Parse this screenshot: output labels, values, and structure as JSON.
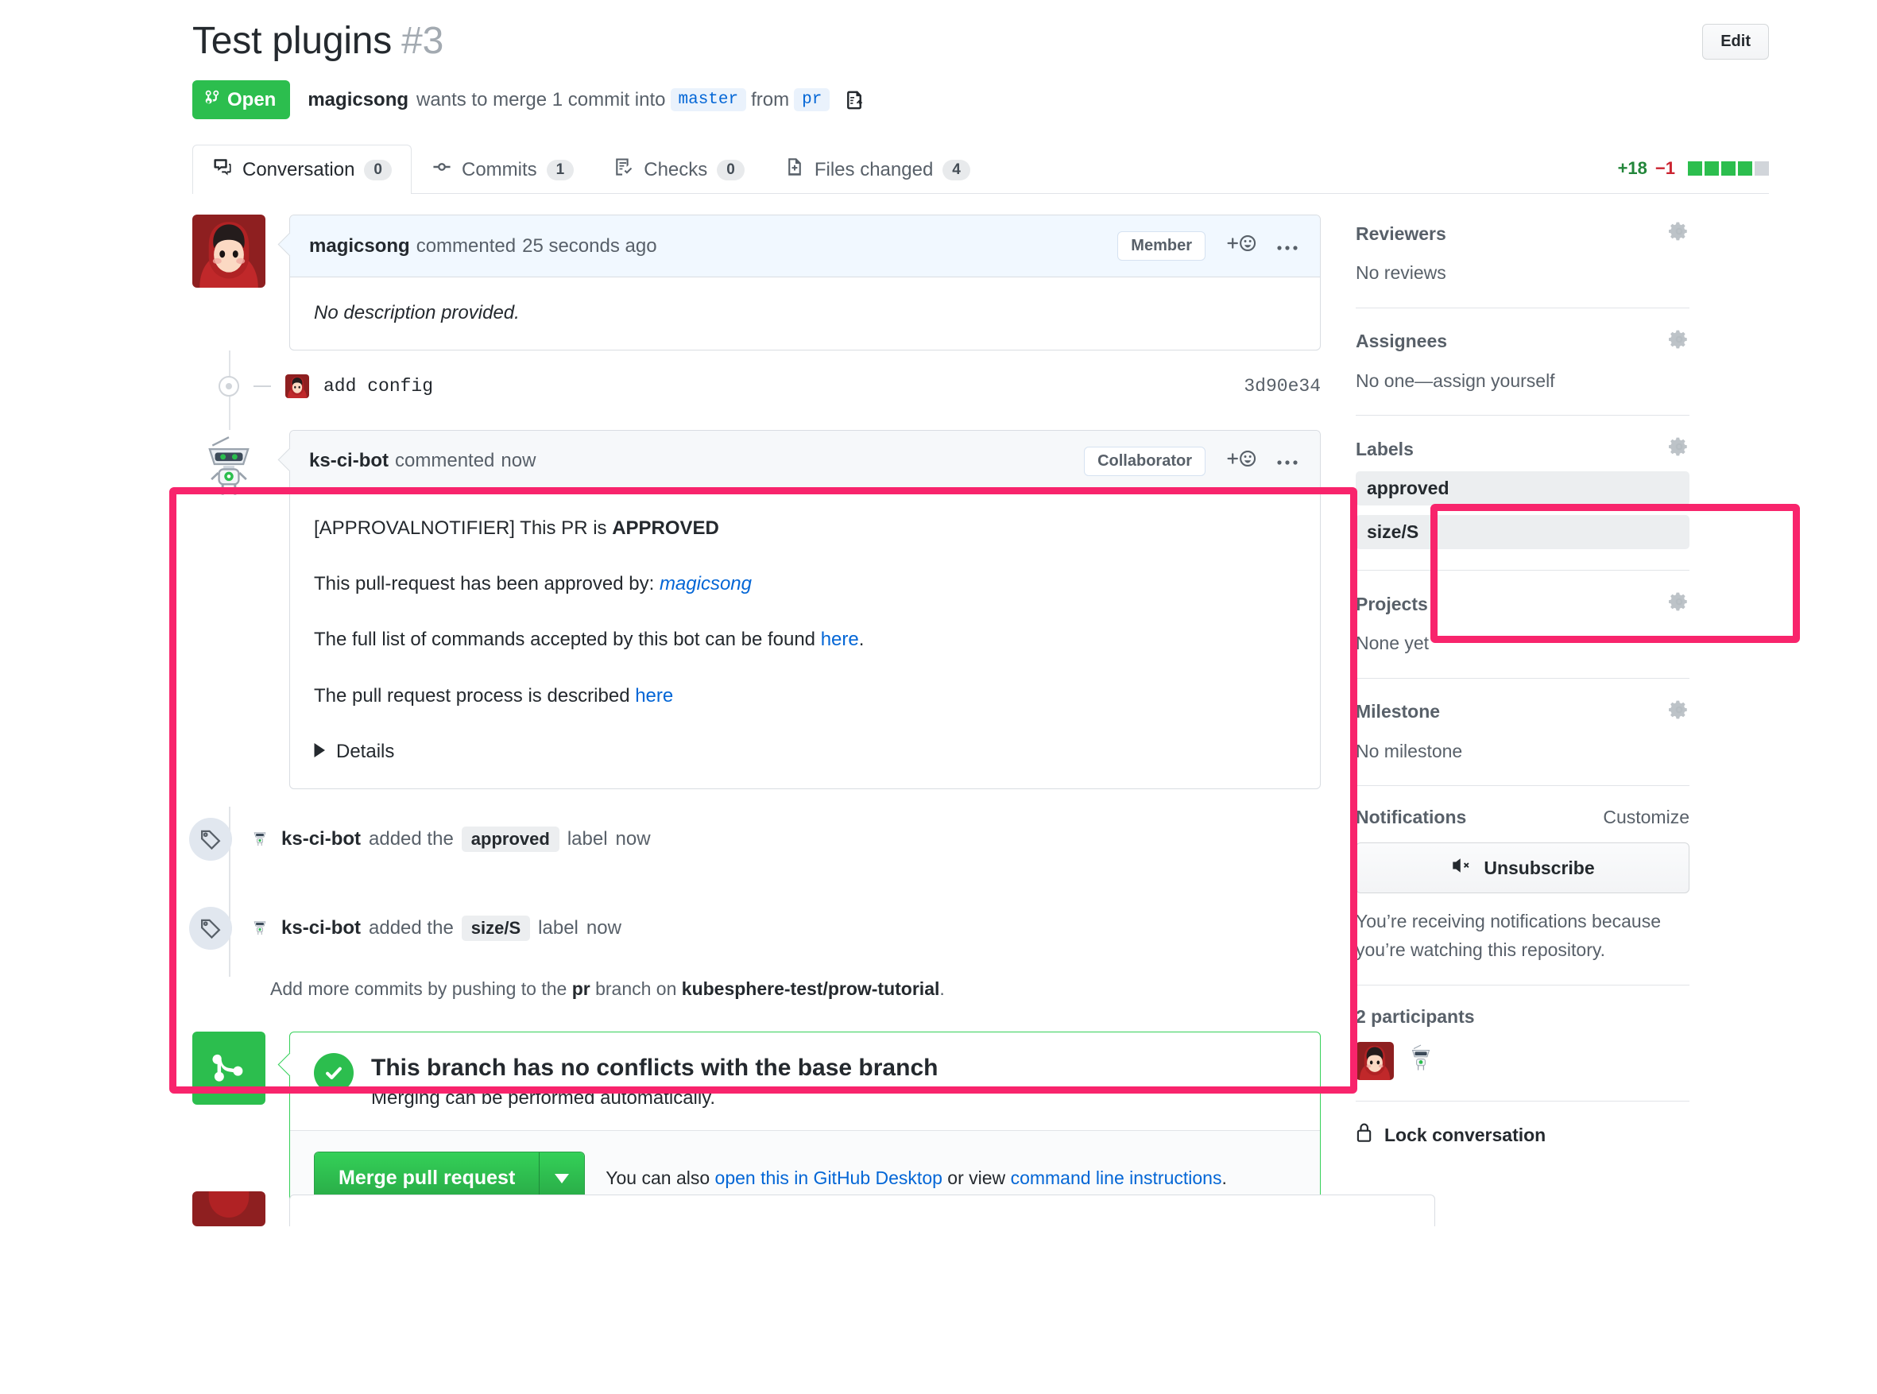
{
  "header": {
    "title": "Test plugins",
    "number": "#3",
    "edit_label": "Edit",
    "state": "Open",
    "author": "magicsong",
    "merge_text_1": "wants to merge 1 commit into",
    "base_branch": "master",
    "from_word": "from",
    "head_branch": "pr"
  },
  "tabs": [
    {
      "label": "Conversation",
      "count": "0",
      "icon": "comment-discussion-icon",
      "active": true
    },
    {
      "label": "Commits",
      "count": "1",
      "icon": "git-commit-icon",
      "active": false
    },
    {
      "label": "Checks",
      "count": "0",
      "icon": "checklist-icon",
      "active": false
    },
    {
      "label": "Files changed",
      "count": "4",
      "icon": "file-diff-icon",
      "active": false
    }
  ],
  "diffstat": {
    "additions": "+18",
    "deletions": "−1",
    "blocks": [
      "on",
      "on",
      "on",
      "on",
      "off"
    ]
  },
  "comments": [
    {
      "author": "magicsong",
      "action": "commented",
      "time": "25 seconds ago",
      "role": "Member",
      "body": "No description provided."
    }
  ],
  "commit": {
    "message": "add config",
    "sha": "3d90e34"
  },
  "bot_comment": {
    "author": "ks-ci-bot",
    "action": "commented",
    "time": "now",
    "role": "Collaborator",
    "line1_prefix": "[APPROVALNOTIFIER] This PR is ",
    "line1_bold": "APPROVED",
    "line2_prefix": "This pull-request has been approved by: ",
    "line2_link": "magicsong",
    "line3_prefix": "The full list of commands accepted by this bot can be found ",
    "line3_link": "here",
    "line3_suffix": ".",
    "line4_prefix": "The pull request process is described ",
    "line4_link": "here",
    "details_label": "Details"
  },
  "events": [
    {
      "actor": "ks-ci-bot",
      "verb": "added the",
      "label": "approved",
      "suffix": "label",
      "time": "now",
      "icon": "tag-icon"
    },
    {
      "actor": "ks-ci-bot",
      "verb": "added the",
      "label": "size/S",
      "suffix": "label",
      "time": "now",
      "icon": "tag-icon"
    }
  ],
  "push_note": {
    "prefix": "Add more commits by pushing to the",
    "branch": "pr",
    "middle": "branch on",
    "repo": "kubesphere-test/prow-tutorial",
    "suffix": "."
  },
  "merge": {
    "heading": "This branch has no conflicts with the base branch",
    "subheading": "Merging can be performed automatically.",
    "button_label": "Merge pull request",
    "note_prefix": "You can also ",
    "note_link_1": "open this in GitHub Desktop",
    "note_middle": " or view ",
    "note_link_2": "command line instructions",
    "note_suffix": "."
  },
  "sidebar": {
    "reviewers": {
      "title": "Reviewers",
      "value": "No reviews",
      "gear": "gear-icon"
    },
    "assignees": {
      "title": "Assignees",
      "value": "No one—assign yourself",
      "gear": "gear-icon"
    },
    "labels": {
      "title": "Labels",
      "gear": "gear-icon",
      "items": [
        "approved",
        "size/S"
      ]
    },
    "projects": {
      "title": "Projects",
      "value": "None yet",
      "gear": "gear-icon"
    },
    "milestone": {
      "title": "Milestone",
      "value": "No milestone",
      "gear": "gear-icon"
    },
    "notifications": {
      "title": "Notifications",
      "customize": "Customize",
      "button_label": "Unsubscribe",
      "note": "You’re receiving notifications because you’re watching this repository."
    },
    "participants": {
      "title": "2 participants"
    },
    "lock": {
      "label": "Lock conversation",
      "icon": "lock-icon"
    }
  },
  "colors": {
    "open_green": "#2cbe4e",
    "link_blue": "#0366d6",
    "highlight_pink": "#f8246c",
    "add_green": "#22863a",
    "del_red": "#cb2431"
  }
}
